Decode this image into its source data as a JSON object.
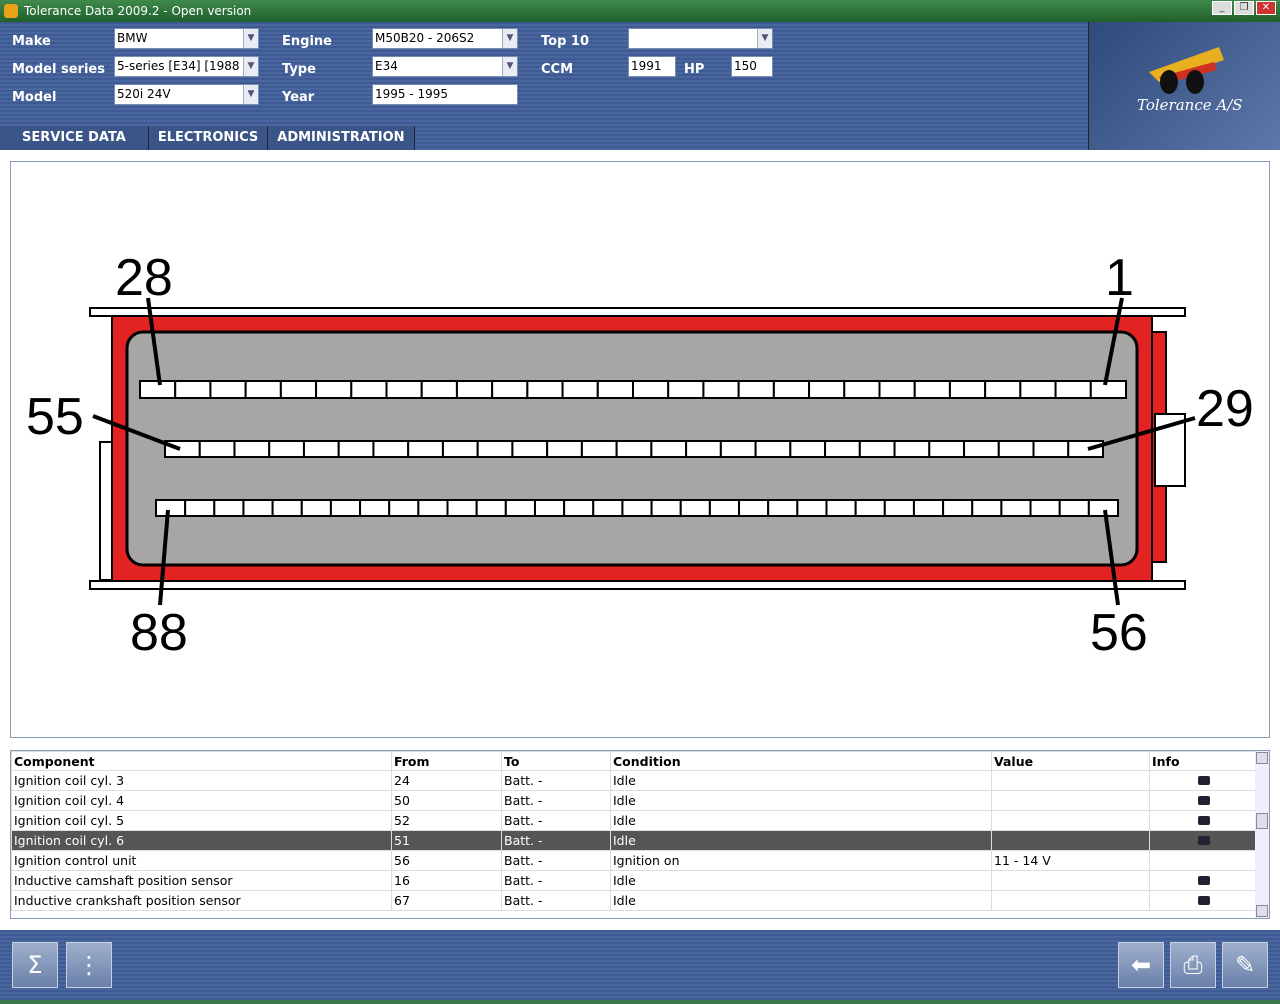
{
  "window": {
    "title": "Tolerance Data 2009.2 - Open version"
  },
  "header": {
    "make": {
      "label": "Make",
      "value": "BMW"
    },
    "model_series": {
      "label": "Model series",
      "value": "5-series [E34] [1988"
    },
    "model": {
      "label": "Model",
      "value": "520i 24V"
    },
    "engine": {
      "label": "Engine",
      "value": "M50B20 - 206S2"
    },
    "type": {
      "label": "Type",
      "value": "E34"
    },
    "year": {
      "label": "Year",
      "value": "1995 - 1995"
    },
    "top10": {
      "label": "Top 10",
      "value": ""
    },
    "ccm": {
      "label": "CCM",
      "value": "1991"
    },
    "hp": {
      "label": "HP",
      "value": "150"
    },
    "logo_text": "Tolerance A/S"
  },
  "tabs": [
    "SERVICE DATA",
    "ELECTRONICS",
    "ADMINISTRATION"
  ],
  "connector": {
    "labels": {
      "top_left": "28",
      "top_right": "1",
      "mid_left": "55",
      "mid_right": "29",
      "bot_left": "88",
      "bot_right": "56"
    },
    "colors": {
      "housing": "#e32222",
      "body": "#a8a5a5"
    }
  },
  "table": {
    "headers": [
      "Component",
      "From",
      "To",
      "Condition",
      "Value",
      "Info"
    ],
    "rows": [
      {
        "component": "Ignition coil cyl. 3",
        "from": "24",
        "to": "Batt. -",
        "condition": "Idle",
        "value": "",
        "info": true
      },
      {
        "component": "Ignition coil cyl. 4",
        "from": "50",
        "to": "Batt. -",
        "condition": "Idle",
        "value": "",
        "info": true
      },
      {
        "component": "Ignition coil cyl. 5",
        "from": "52",
        "to": "Batt. -",
        "condition": "Idle",
        "value": "",
        "info": true
      },
      {
        "component": "Ignition coil cyl. 6",
        "from": "51",
        "to": "Batt. -",
        "condition": "Idle",
        "value": "",
        "info": true,
        "selected": true
      },
      {
        "component": "Ignition control unit",
        "from": "56",
        "to": "Batt. -",
        "condition": "Ignition on",
        "value": "11 - 14 V",
        "info": false
      },
      {
        "component": "Inductive camshaft position sensor",
        "from": "16",
        "to": "Batt. -",
        "condition": "Idle",
        "value": "",
        "info": true
      },
      {
        "component": "Inductive crankshaft position sensor",
        "from": "67",
        "to": "Batt. -",
        "condition": "Idle",
        "value": "",
        "info": true
      }
    ]
  }
}
